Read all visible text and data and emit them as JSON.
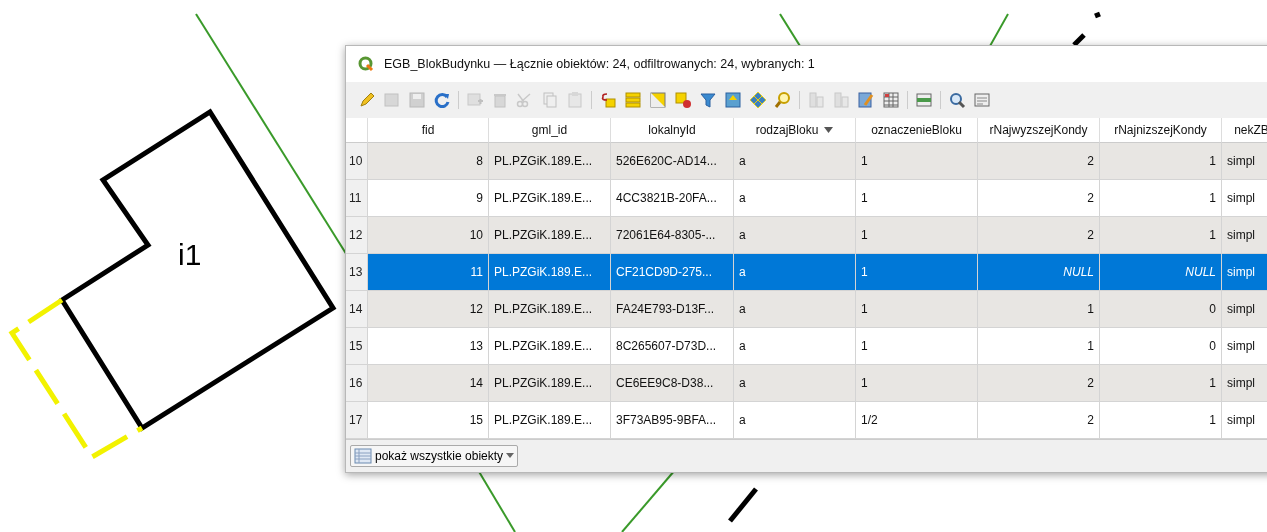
{
  "map": {
    "label": "i1"
  },
  "window": {
    "title": "EGB_BlokBudynku — Łącznie obiektów: 24, odfiltrowanych: 24, wybranych: 1"
  },
  "table": {
    "columns": [
      {
        "label": "fid",
        "kind": "number",
        "sorted": false
      },
      {
        "label": "gml_id",
        "kind": "text",
        "sorted": false
      },
      {
        "label": "lokalnyId",
        "kind": "text",
        "sorted": false
      },
      {
        "label": "rodzajBloku",
        "kind": "text",
        "sorted": true
      },
      {
        "label": "oznaczenieBloku",
        "kind": "text",
        "sorted": false
      },
      {
        "label": "rNajwyzszejKondy",
        "kind": "number",
        "sorted": false
      },
      {
        "label": "rNajnizszejKondy",
        "kind": "number",
        "sorted": false
      },
      {
        "label": "nekZB",
        "kind": "text",
        "sorted": false
      }
    ],
    "rows": [
      {
        "number": "10",
        "selected": false,
        "cells": [
          "8",
          "PL.PZGiK.189.E...",
          "526E620C-AD14...",
          "a",
          "1",
          "2",
          "1",
          "simpl"
        ]
      },
      {
        "number": "11",
        "selected": false,
        "cells": [
          "9",
          "PL.PZGiK.189.E...",
          "4CC3821B-20FA...",
          "a",
          "1",
          "2",
          "1",
          "simpl"
        ]
      },
      {
        "number": "12",
        "selected": false,
        "cells": [
          "10",
          "PL.PZGiK.189.E...",
          "72061E64-8305-...",
          "a",
          "1",
          "2",
          "1",
          "simpl"
        ]
      },
      {
        "number": "13",
        "selected": true,
        "cells": [
          "11",
          "PL.PZGiK.189.E...",
          "CF21CD9D-275...",
          "a",
          "1",
          {
            "text": "NULL",
            "kind": "null"
          },
          {
            "text": "NULL",
            "kind": "null"
          },
          "simpl"
        ]
      },
      {
        "number": "14",
        "selected": false,
        "cells": [
          "12",
          "PL.PZGiK.189.E...",
          "FA24E793-D13F...",
          "a",
          "1",
          "1",
          "0",
          "simpl"
        ]
      },
      {
        "number": "15",
        "selected": false,
        "cells": [
          "13",
          "PL.PZGiK.189.E...",
          "8C265607-D73D...",
          "a",
          "1",
          "1",
          "0",
          "simpl"
        ]
      },
      {
        "number": "16",
        "selected": false,
        "cells": [
          "14",
          "PL.PZGiK.189.E...",
          "CE6EE9C8-D38...",
          "a",
          "1",
          "2",
          "1",
          "simpl"
        ]
      },
      {
        "number": "17",
        "selected": false,
        "cells": [
          "15",
          "PL.PZGiK.189.E...",
          "3F73AB95-9BFA...",
          "a",
          "1/2",
          "2",
          "1",
          "simpl"
        ]
      }
    ]
  },
  "footer": {
    "button": "pokaż wszystkie obiekty"
  }
}
